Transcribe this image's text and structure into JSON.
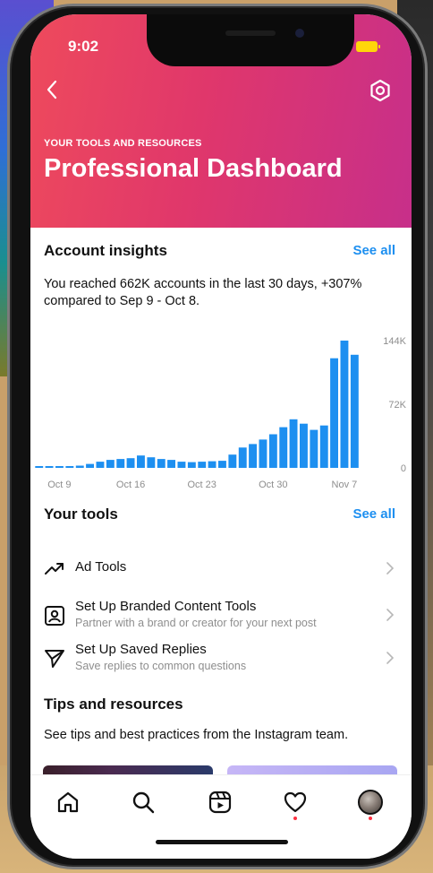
{
  "status": {
    "time": "9:02"
  },
  "header": {
    "eyebrow": "YOUR TOOLS AND RESOURCES",
    "title": "Professional Dashboard",
    "back_icon": "chevron-left-icon",
    "settings_icon": "gear-icon"
  },
  "insights": {
    "title": "Account insights",
    "see_all": "See all",
    "summary": "You reached 662K accounts in the last 30 days, +307% compared to Sep 9 - Oct 8."
  },
  "chart_data": {
    "type": "bar",
    "title": "",
    "xlabel": "",
    "ylabel": "",
    "ylim": [
      0,
      144000
    ],
    "y_ticks": [
      "144K",
      "72K",
      "0"
    ],
    "x_tick_labels": [
      "Oct 9",
      "Oct 16",
      "Oct 23",
      "Oct 30",
      "Nov 7"
    ],
    "x_tick_indices": [
      2,
      9,
      16,
      23,
      30
    ],
    "values": [
      1800,
      1800,
      1800,
      1800,
      2500,
      4500,
      7000,
      9000,
      10000,
      11000,
      14000,
      12000,
      10000,
      9000,
      7000,
      6500,
      7000,
      7500,
      8000,
      15000,
      23000,
      27000,
      32000,
      38000,
      46000,
      55000,
      50000,
      43000,
      48000,
      124000,
      144000,
      128000
    ],
    "bar_color": "#1d8ff0",
    "grid": false
  },
  "tools": {
    "title": "Your tools",
    "see_all": "See all",
    "items": [
      {
        "icon": "trending-up-icon",
        "title": "Ad Tools",
        "subtitle": ""
      },
      {
        "icon": "branded-content-icon",
        "title": "Set Up Branded Content Tools",
        "subtitle": "Partner with a brand or creator for your next post"
      },
      {
        "icon": "paper-plane-icon",
        "title": "Set Up Saved Replies",
        "subtitle": "Save replies to common questions"
      }
    ]
  },
  "tips": {
    "title": "Tips and resources",
    "summary": "See tips and best practices from the Instagram team."
  },
  "tabbar": {
    "items": [
      "home-icon",
      "search-icon",
      "reels-icon",
      "heart-icon",
      "profile-avatar"
    ]
  }
}
